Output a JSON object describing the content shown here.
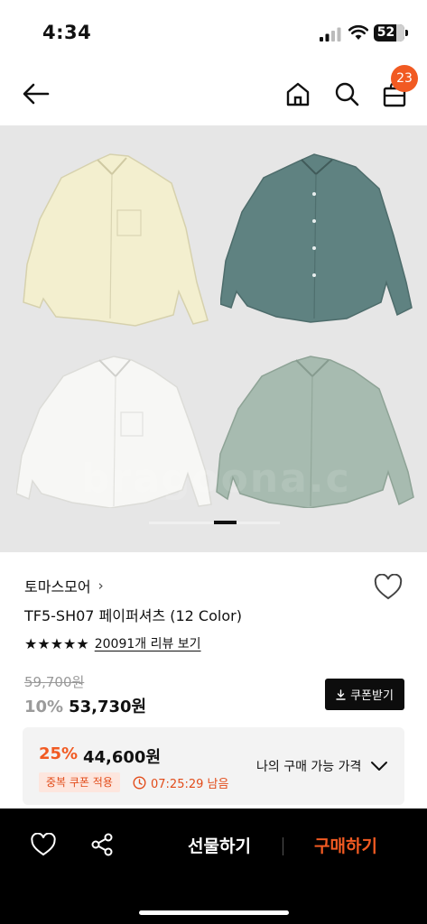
{
  "status_bar": {
    "time": "4:34",
    "battery": "52"
  },
  "nav": {
    "cart_count": "23",
    "icons": [
      "back-arrow-icon",
      "home-icon",
      "search-icon",
      "cart-icon"
    ]
  },
  "gallery": {
    "watermark": "bragoona.c",
    "shirt_colors": [
      "#f3efcf",
      "#5f8281",
      "#f7f7f5",
      "#a7bbb0"
    ]
  },
  "product": {
    "brand": "토마스모어",
    "brand_chevron": "›",
    "name": "TF5-SH07 페이퍼셔츠 (12 Color)",
    "stars": "★★★★★",
    "review_link": "20091개 리뷰 보기",
    "original_price": "59,700원",
    "discount_rate": "10%",
    "discount_price": "53,730원",
    "coupon_button": "쿠폰받기"
  },
  "best_price": {
    "rate": "25%",
    "price": "44,600원",
    "tag": "중복 쿠폰 적용",
    "timer": "07:25:29 남음",
    "my_price_label": "나의 구매 가능 가격"
  },
  "bottom_bar": {
    "gift_label": "선물하기",
    "buy_label": "구매하기"
  },
  "colors": {
    "accent": "#f15a22",
    "dark": "#0d0d0d"
  }
}
